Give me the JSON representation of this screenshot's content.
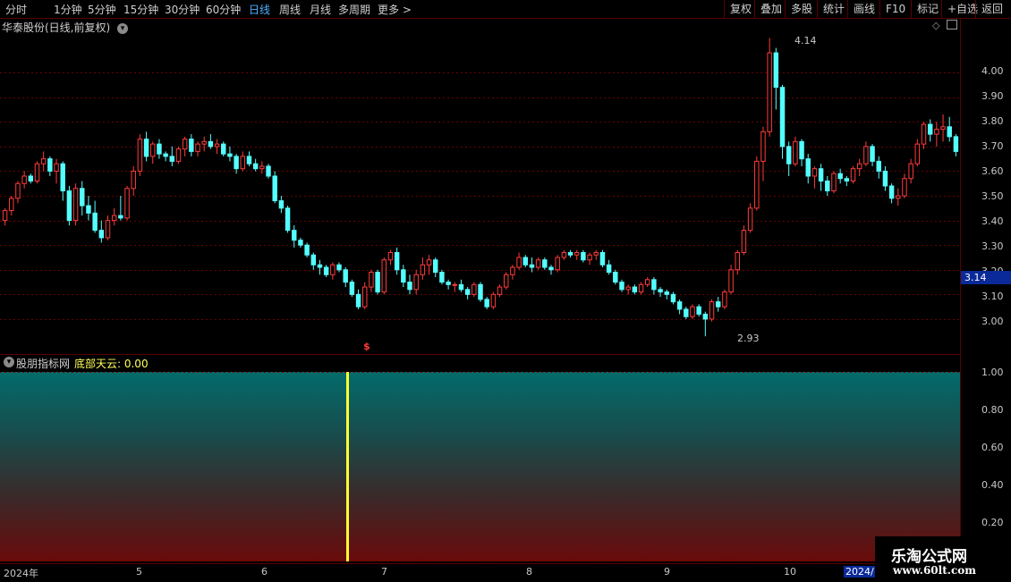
{
  "toolbar": {
    "periods": [
      "分时",
      "1分钟",
      "5分钟",
      "15分钟",
      "30分钟",
      "60分钟",
      "日线",
      "周线",
      "月线",
      "多周期",
      "更多 >"
    ],
    "active_period": "日线",
    "right_buttons": [
      "复权",
      "叠加",
      "多股",
      "统计",
      "画线",
      "F10",
      "标记",
      "+自选",
      "返回"
    ]
  },
  "chart_header": {
    "title": "华泰股份(日线,前复权)"
  },
  "price_axis": [
    "4.00",
    "3.90",
    "3.80",
    "3.70",
    "3.60",
    "3.50",
    "3.40",
    "3.30",
    "3.20",
    "3.10",
    "3.00"
  ],
  "current_price": "3.14",
  "annotations": {
    "high": "4.14",
    "low": "2.93",
    "marker": "$"
  },
  "indicator": {
    "name": "股朋指标网",
    "value_text": "底部天云: 0.00",
    "axis": [
      "1.00",
      "0.80",
      "0.60",
      "0.40",
      "0.20"
    ]
  },
  "x_axis": [
    "2024年",
    "5",
    "6",
    "7",
    "8",
    "9",
    "10",
    "2024/1"
  ],
  "watermark": {
    "title": "乐淘公式网",
    "url": "www.60lt.com"
  },
  "colors": {
    "up": "#ff3b3b",
    "down": "#54ffff",
    "signal": "#ffff33",
    "active_tab": "#4fb0ff"
  },
  "chart_data": {
    "type": "candlestick",
    "price_range": [
      2.88,
      4.2
    ],
    "candles": [
      [
        3.4,
        3.45,
        3.38,
        3.44
      ],
      [
        3.44,
        3.5,
        3.42,
        3.49
      ],
      [
        3.49,
        3.56,
        3.47,
        3.55
      ],
      [
        3.55,
        3.6,
        3.53,
        3.58
      ],
      [
        3.58,
        3.59,
        3.55,
        3.56
      ],
      [
        3.56,
        3.64,
        3.55,
        3.63
      ],
      [
        3.63,
        3.68,
        3.6,
        3.65
      ],
      [
        3.65,
        3.66,
        3.58,
        3.6
      ],
      [
        3.6,
        3.65,
        3.55,
        3.63
      ],
      [
        3.63,
        3.64,
        3.48,
        3.52
      ],
      [
        3.52,
        3.54,
        3.38,
        3.4
      ],
      [
        3.4,
        3.55,
        3.38,
        3.53
      ],
      [
        3.53,
        3.56,
        3.42,
        3.46
      ],
      [
        3.46,
        3.5,
        3.4,
        3.43
      ],
      [
        3.43,
        3.48,
        3.35,
        3.36
      ],
      [
        3.36,
        3.4,
        3.31,
        3.33
      ],
      [
        3.33,
        3.42,
        3.32,
        3.4
      ],
      [
        3.4,
        3.45,
        3.38,
        3.42
      ],
      [
        3.42,
        3.5,
        3.4,
        3.41
      ],
      [
        3.41,
        3.54,
        3.4,
        3.53
      ],
      [
        3.53,
        3.62,
        3.5,
        3.6
      ],
      [
        3.6,
        3.75,
        3.58,
        3.73
      ],
      [
        3.73,
        3.76,
        3.64,
        3.66
      ],
      [
        3.66,
        3.72,
        3.63,
        3.71
      ],
      [
        3.71,
        3.73,
        3.65,
        3.67
      ],
      [
        3.67,
        3.68,
        3.64,
        3.66
      ],
      [
        3.66,
        3.7,
        3.62,
        3.64
      ],
      [
        3.64,
        3.7,
        3.63,
        3.69
      ],
      [
        3.69,
        3.74,
        3.66,
        3.73
      ],
      [
        3.73,
        3.75,
        3.66,
        3.68
      ],
      [
        3.68,
        3.72,
        3.66,
        3.71
      ],
      [
        3.71,
        3.74,
        3.68,
        3.72
      ],
      [
        3.72,
        3.75,
        3.69,
        3.7
      ],
      [
        3.7,
        3.73,
        3.67,
        3.71
      ],
      [
        3.71,
        3.72,
        3.66,
        3.67
      ],
      [
        3.67,
        3.7,
        3.64,
        3.66
      ],
      [
        3.66,
        3.67,
        3.59,
        3.61
      ],
      [
        3.61,
        3.68,
        3.6,
        3.66
      ],
      [
        3.66,
        3.68,
        3.62,
        3.63
      ],
      [
        3.63,
        3.65,
        3.6,
        3.61
      ],
      [
        3.61,
        3.64,
        3.59,
        3.62
      ],
      [
        3.62,
        3.63,
        3.57,
        3.58
      ],
      [
        3.58,
        3.6,
        3.47,
        3.48
      ],
      [
        3.48,
        3.5,
        3.43,
        3.45
      ],
      [
        3.45,
        3.46,
        3.35,
        3.36
      ],
      [
        3.36,
        3.38,
        3.29,
        3.32
      ],
      [
        3.32,
        3.33,
        3.29,
        3.3
      ],
      [
        3.3,
        3.31,
        3.25,
        3.26
      ],
      [
        3.26,
        3.27,
        3.2,
        3.22
      ],
      [
        3.22,
        3.24,
        3.18,
        3.21
      ],
      [
        3.21,
        3.22,
        3.17,
        3.18
      ],
      [
        3.18,
        3.23,
        3.16,
        3.22
      ],
      [
        3.22,
        3.23,
        3.19,
        3.2
      ],
      [
        3.2,
        3.21,
        3.13,
        3.15
      ],
      [
        3.15,
        3.16,
        3.09,
        3.1
      ],
      [
        3.1,
        3.12,
        3.04,
        3.05
      ],
      [
        3.05,
        3.15,
        3.04,
        3.13
      ],
      [
        3.13,
        3.2,
        3.11,
        3.19
      ],
      [
        3.19,
        3.2,
        3.1,
        3.11
      ],
      [
        3.11,
        3.25,
        3.1,
        3.24
      ],
      [
        3.24,
        3.28,
        3.22,
        3.27
      ],
      [
        3.27,
        3.29,
        3.18,
        3.2
      ],
      [
        3.2,
        3.22,
        3.13,
        3.15
      ],
      [
        3.15,
        3.18,
        3.1,
        3.12
      ],
      [
        3.12,
        3.2,
        3.1,
        3.18
      ],
      [
        3.18,
        3.25,
        3.16,
        3.22
      ],
      [
        3.22,
        3.26,
        3.18,
        3.24
      ],
      [
        3.24,
        3.25,
        3.17,
        3.19
      ],
      [
        3.19,
        3.2,
        3.14,
        3.15
      ],
      [
        3.15,
        3.16,
        3.12,
        3.14
      ],
      [
        3.14,
        3.15,
        3.11,
        3.14
      ],
      [
        3.14,
        3.16,
        3.11,
        3.12
      ],
      [
        3.12,
        3.13,
        3.08,
        3.1
      ],
      [
        3.1,
        3.15,
        3.09,
        3.14
      ],
      [
        3.14,
        3.15,
        3.07,
        3.08
      ],
      [
        3.08,
        3.09,
        3.04,
        3.05
      ],
      [
        3.05,
        3.11,
        3.04,
        3.1
      ],
      [
        3.1,
        3.14,
        3.09,
        3.13
      ],
      [
        3.13,
        3.19,
        3.12,
        3.18
      ],
      [
        3.18,
        3.22,
        3.16,
        3.21
      ],
      [
        3.21,
        3.27,
        3.2,
        3.25
      ],
      [
        3.25,
        3.26,
        3.21,
        3.22
      ],
      [
        3.22,
        3.25,
        3.19,
        3.21
      ],
      [
        3.21,
        3.25,
        3.2,
        3.24
      ],
      [
        3.24,
        3.25,
        3.2,
        3.21
      ],
      [
        3.21,
        3.22,
        3.18,
        3.2
      ],
      [
        3.2,
        3.26,
        3.19,
        3.25
      ],
      [
        3.25,
        3.28,
        3.24,
        3.27
      ],
      [
        3.27,
        3.28,
        3.25,
        3.26
      ],
      [
        3.26,
        3.28,
        3.24,
        3.27
      ],
      [
        3.27,
        3.28,
        3.23,
        3.24
      ],
      [
        3.24,
        3.27,
        3.22,
        3.26
      ],
      [
        3.26,
        3.28,
        3.24,
        3.27
      ],
      [
        3.27,
        3.28,
        3.21,
        3.22
      ],
      [
        3.22,
        3.24,
        3.18,
        3.19
      ],
      [
        3.19,
        3.2,
        3.14,
        3.15
      ],
      [
        3.15,
        3.16,
        3.11,
        3.12
      ],
      [
        3.12,
        3.14,
        3.1,
        3.13
      ],
      [
        3.13,
        3.14,
        3.1,
        3.11
      ],
      [
        3.11,
        3.15,
        3.1,
        3.14
      ],
      [
        3.14,
        3.17,
        3.13,
        3.16
      ],
      [
        3.16,
        3.17,
        3.1,
        3.12
      ],
      [
        3.12,
        3.13,
        3.09,
        3.11
      ],
      [
        3.11,
        3.12,
        3.08,
        3.1
      ],
      [
        3.1,
        3.11,
        3.06,
        3.07
      ],
      [
        3.07,
        3.08,
        3.02,
        3.04
      ],
      [
        3.04,
        3.05,
        3.0,
        3.01
      ],
      [
        3.01,
        3.06,
        3.0,
        3.05
      ],
      [
        3.05,
        3.06,
        3.01,
        3.02
      ],
      [
        3.02,
        3.03,
        2.93,
        3.0
      ],
      [
        3.0,
        3.08,
        2.99,
        3.07
      ],
      [
        3.07,
        3.09,
        3.03,
        3.05
      ],
      [
        3.05,
        3.12,
        3.04,
        3.11
      ],
      [
        3.11,
        3.22,
        3.1,
        3.2
      ],
      [
        3.2,
        3.28,
        3.18,
        3.27
      ],
      [
        3.27,
        3.38,
        3.26,
        3.36
      ],
      [
        3.36,
        3.47,
        3.35,
        3.45
      ],
      [
        3.45,
        3.66,
        3.44,
        3.64
      ],
      [
        3.64,
        3.78,
        3.56,
        3.76
      ],
      [
        3.76,
        4.14,
        3.74,
        4.08
      ],
      [
        4.08,
        4.1,
        3.85,
        3.94
      ],
      [
        3.94,
        3.95,
        3.65,
        3.7
      ],
      [
        3.7,
        3.72,
        3.58,
        3.63
      ],
      [
        3.63,
        3.74,
        3.62,
        3.72
      ],
      [
        3.72,
        3.73,
        3.62,
        3.65
      ],
      [
        3.65,
        3.67,
        3.55,
        3.58
      ],
      [
        3.58,
        3.62,
        3.53,
        3.61
      ],
      [
        3.61,
        3.63,
        3.52,
        3.56
      ],
      [
        3.56,
        3.58,
        3.5,
        3.52
      ],
      [
        3.52,
        3.6,
        3.51,
        3.59
      ],
      [
        3.59,
        3.61,
        3.55,
        3.57
      ],
      [
        3.57,
        3.58,
        3.54,
        3.56
      ],
      [
        3.56,
        3.62,
        3.55,
        3.61
      ],
      [
        3.61,
        3.65,
        3.58,
        3.63
      ],
      [
        3.63,
        3.72,
        3.62,
        3.7
      ],
      [
        3.7,
        3.71,
        3.62,
        3.64
      ],
      [
        3.64,
        3.66,
        3.57,
        3.6
      ],
      [
        3.6,
        3.62,
        3.52,
        3.54
      ],
      [
        3.54,
        3.55,
        3.47,
        3.49
      ],
      [
        3.49,
        3.53,
        3.46,
        3.5
      ],
      [
        3.5,
        3.59,
        3.49,
        3.57
      ],
      [
        3.57,
        3.65,
        3.55,
        3.63
      ],
      [
        3.63,
        3.73,
        3.62,
        3.71
      ],
      [
        3.71,
        3.8,
        3.69,
        3.79
      ],
      [
        3.79,
        3.81,
        3.72,
        3.75
      ],
      [
        3.75,
        3.8,
        3.7,
        3.77
      ],
      [
        3.77,
        3.83,
        3.72,
        3.78
      ],
      [
        3.78,
        3.82,
        3.72,
        3.74
      ],
      [
        3.74,
        3.75,
        3.66,
        3.68
      ]
    ],
    "indicator_signal_index": 55
  }
}
